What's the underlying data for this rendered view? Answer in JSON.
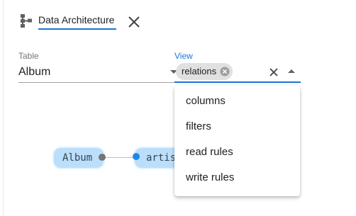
{
  "tab": {
    "title": "Data Architecture",
    "icon": "schema-icon",
    "close_icon": "close-icon"
  },
  "table_field": {
    "label": "Table",
    "value": "Album",
    "icon": "dropdown-arrow-icon"
  },
  "view_field": {
    "label": "View",
    "chips": [
      {
        "label": "relations",
        "remove_icon": "cancel-circle-icon"
      }
    ],
    "clear_icon": "close-icon",
    "toggle_icon": "dropdown-arrow-up-icon"
  },
  "menu": {
    "items": [
      {
        "label": "columns"
      },
      {
        "label": "filters"
      },
      {
        "label": "read rules"
      },
      {
        "label": "write rules"
      }
    ]
  },
  "graph": {
    "nodes": [
      {
        "label": "Album"
      },
      {
        "label": "artis"
      }
    ]
  },
  "colors": {
    "accent": "#1976d2",
    "node_fill": "#bbdefb",
    "port_in": "#1e88e5",
    "port_out": "#757575",
    "chip": "#e0e0e0"
  }
}
